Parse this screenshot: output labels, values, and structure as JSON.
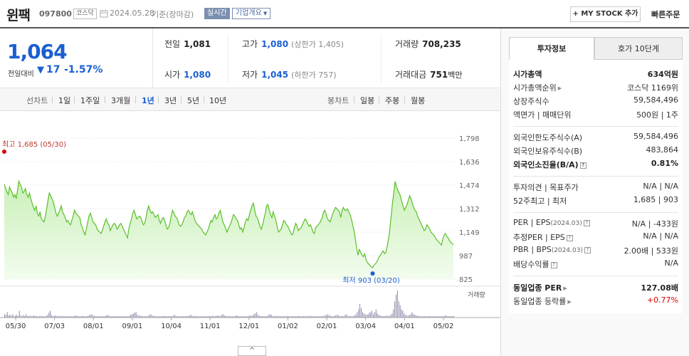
{
  "header": {
    "name": "윈팩",
    "code": "097800",
    "market": "코스닥",
    "date": "2024.05.28",
    "basis": "기준(장마감)",
    "realtime": "실시간",
    "overview": "기업개요",
    "mystock": "+ MY STOCK 추가",
    "quick_order": "빠른주문"
  },
  "price": {
    "current": "1,064",
    "change_label": "전일대비",
    "change_arrow": "▼",
    "change": "17",
    "change_pct": "-1.57%"
  },
  "quote": {
    "prev_label": "전일",
    "prev": "1,081",
    "high_label": "고가",
    "high": "1,080",
    "upper_limit": "(상한가 1,405)",
    "volume_label": "거래량",
    "volume": "708,235",
    "open_label": "시가",
    "open": "1,080",
    "low_label": "저가",
    "low": "1,045",
    "lower_limit": "(하한가 757)",
    "amount_label": "거래대금",
    "amount": "751",
    "amount_unit": "백만"
  },
  "period": {
    "line_label": "선차트",
    "line_tabs": [
      "1일",
      "1주일",
      "3개월",
      "1년",
      "3년",
      "5년",
      "10년"
    ],
    "active": "1년",
    "candle_label": "봉차트",
    "candle_tabs": [
      "일봉",
      "주봉",
      "월봉"
    ]
  },
  "chart_data": {
    "type": "area",
    "y_ticks": [
      "1,798",
      "1,636",
      "1,474",
      "1,312",
      "1,149",
      "987",
      "825"
    ],
    "ylim": [
      825,
      1798
    ],
    "x_ticks": [
      "05/30",
      "07/03",
      "08/01",
      "09/01",
      "10/04",
      "11/01",
      "12/01",
      "01/02",
      "02/01",
      "03/04",
      "04/01",
      "05/02"
    ],
    "high_annotation": "최고 1,685 (05/30)",
    "low_annotation": "최저 903 (03/20)",
    "volume_label": "거래량",
    "series": [
      {
        "values": [
          1480,
          1450,
          1430,
          1410,
          1460,
          1440,
          1420,
          1390,
          1410,
          1380,
          1440,
          1500,
          1480,
          1460,
          1420,
          1430,
          1450,
          1410,
          1390,
          1420,
          1380,
          1350,
          1320,
          1300,
          1330,
          1280,
          1260,
          1290,
          1240,
          1230,
          1220,
          1260,
          1310,
          1370,
          1420,
          1400,
          1380,
          1360,
          1320,
          1280,
          1260,
          1280,
          1300,
          1330,
          1290,
          1270,
          1250,
          1220,
          1230,
          1210,
          1200,
          1230,
          1260,
          1300,
          1280,
          1270,
          1260,
          1250,
          1200,
          1180,
          1150,
          1130,
          1170,
          1220,
          1260,
          1280,
          1250,
          1220,
          1210,
          1200,
          1170,
          1160,
          1150,
          1140,
          1160,
          1190,
          1220,
          1240,
          1210,
          1200,
          1160,
          1180,
          1200,
          1210,
          1200,
          1170,
          1180,
          1200,
          1210,
          1190,
          1170,
          1150,
          1130,
          1110,
          1170,
          1210,
          1240,
          1280,
          1300,
          1270,
          1240,
          1250,
          1260,
          1250,
          1220,
          1200,
          1210,
          1250,
          1300,
          1330,
          1300,
          1280,
          1290,
          1270,
          1250,
          1260,
          1270,
          1230,
          1210,
          1240,
          1250,
          1230,
          1200,
          1170,
          1180,
          1210,
          1260,
          1300,
          1280,
          1260,
          1250,
          1230,
          1200,
          1190,
          1200,
          1220,
          1250,
          1260,
          1290,
          1300,
          1280,
          1270,
          1290,
          1260,
          1230,
          1210,
          1200,
          1190,
          1180,
          1170,
          1150,
          1140,
          1130,
          1150,
          1170,
          1200,
          1230,
          1220,
          1250,
          1270,
          1240,
          1250,
          1280,
          1300,
          1260,
          1220,
          1200,
          1180,
          1150,
          1170,
          1190,
          1210,
          1240,
          1270,
          1260,
          1240,
          1230,
          1200,
          1170,
          1180,
          1150,
          1180,
          1220,
          1240,
          1230,
          1270,
          1300,
          1330,
          1350,
          1300,
          1260,
          1250,
          1220,
          1190,
          1170,
          1200,
          1240,
          1280,
          1330,
          1340,
          1300,
          1270,
          1250,
          1290,
          1260,
          1230,
          1190,
          1150,
          1160,
          1170,
          1200,
          1230,
          1220,
          1200,
          1190,
          1170,
          1150,
          1130,
          1140,
          1180,
          1210,
          1190,
          1160,
          1170,
          1180,
          1200,
          1220,
          1240,
          1230,
          1210,
          1190,
          1200,
          1180,
          1150,
          1140,
          1180,
          1190,
          1200,
          1210,
          1230,
          1250,
          1290,
          1300,
          1270,
          1240,
          1230,
          1220,
          1250,
          1280,
          1300,
          1320,
          1310,
          1300,
          1290,
          1250,
          1300,
          1320,
          1300,
          1300,
          1310,
          1290,
          1270,
          1240,
          1200,
          1160,
          1100,
          1040,
          990,
          1030,
          1010,
          990,
          980,
          1000,
          960,
          940,
          930,
          920,
          910,
          903,
          920,
          930,
          940,
          960,
          980,
          990,
          1010,
          1020,
          1000,
          1010,
          1050,
          1100,
          1170,
          1260,
          1350,
          1420,
          1500,
          1460,
          1440,
          1420,
          1400,
          1360,
          1330,
          1300,
          1320,
          1340,
          1370,
          1400,
          1380,
          1350,
          1320,
          1300,
          1290,
          1260,
          1240,
          1220,
          1200,
          1180,
          1160,
          1170,
          1200,
          1190,
          1170,
          1150,
          1140,
          1130,
          1120,
          1100,
          1090,
          1080,
          1070,
          1060,
          1100,
          1130,
          1140,
          1120,
          1110,
          1090,
          1080,
          1070,
          1064
        ]
      }
    ],
    "volume_values": [
      0.12,
      0.1,
      0.2,
      0.08,
      0.1,
      0.07,
      0.12,
      0.05,
      0.08,
      0.1,
      0.06,
      0.25,
      0.08,
      0.05,
      0.1,
      0.06,
      0.12,
      0.06,
      0.05,
      0.07,
      0.05,
      0.06,
      0.08,
      0.05,
      0.06,
      0.05,
      0.05,
      0.06,
      0.05,
      0.05,
      0.05,
      0.06,
      0.1,
      0.18,
      0.25,
      0.1,
      0.05,
      0.06,
      0.08,
      0.05,
      0.05,
      0.06,
      0.06,
      0.05,
      0.05,
      0.05,
      0.05,
      0.05,
      0.05,
      0.05,
      0.05,
      0.05,
      0.06,
      0.08,
      0.06,
      0.05,
      0.05,
      0.05,
      0.06,
      0.05,
      0.05,
      0.05,
      0.06,
      0.08,
      0.1,
      0.12,
      0.08,
      0.06,
      0.05,
      0.05,
      0.05,
      0.05,
      0.05,
      0.05,
      0.05,
      0.06,
      0.08,
      0.1,
      0.06,
      0.05,
      0.06,
      0.05,
      0.05,
      0.05,
      0.05,
      0.05,
      0.05,
      0.05,
      0.05,
      0.05,
      0.05,
      0.05,
      0.05,
      0.06,
      0.1,
      0.12,
      0.15,
      0.18,
      0.2,
      0.1,
      0.06,
      0.08,
      0.06,
      0.05,
      0.05,
      0.05,
      0.05,
      0.06,
      0.1,
      0.12,
      0.08,
      0.06,
      0.05,
      0.05,
      0.05,
      0.05,
      0.05,
      0.05,
      0.05,
      0.06,
      0.05,
      0.05,
      0.05,
      0.05,
      0.05,
      0.05,
      0.08,
      0.1,
      0.06,
      0.05,
      0.05,
      0.05,
      0.05,
      0.05,
      0.05,
      0.05,
      0.06,
      0.05,
      0.08,
      0.1,
      0.06,
      0.05,
      0.06,
      0.05,
      0.05,
      0.05,
      0.05,
      0.05,
      0.05,
      0.05,
      0.05,
      0.05,
      0.05,
      0.05,
      0.05,
      0.06,
      0.06,
      0.05,
      0.06,
      0.08,
      0.06,
      0.06,
      0.1,
      0.12,
      0.08,
      0.06,
      0.05,
      0.05,
      0.05,
      0.05,
      0.05,
      0.05,
      0.06,
      0.08,
      0.06,
      0.05,
      0.05,
      0.05,
      0.05,
      0.05,
      0.05,
      0.05,
      0.06,
      0.08,
      0.06,
      0.08,
      0.12,
      0.15,
      0.2,
      0.1,
      0.06,
      0.06,
      0.05,
      0.05,
      0.05,
      0.05,
      0.06,
      0.1,
      0.12,
      0.1,
      0.06,
      0.05,
      0.06,
      0.06,
      0.05,
      0.05,
      0.05,
      0.05,
      0.05,
      0.05,
      0.05,
      0.06,
      0.05,
      0.05,
      0.05,
      0.05,
      0.05,
      0.05,
      0.05,
      0.06,
      0.05,
      0.05,
      0.05,
      0.05,
      0.05,
      0.05,
      0.05,
      0.06,
      0.06,
      0.05,
      0.05,
      0.05,
      0.05,
      0.05,
      0.05,
      0.05,
      0.05,
      0.06,
      0.06,
      0.08,
      0.1,
      0.12,
      0.08,
      0.06,
      0.05,
      0.05,
      0.06,
      0.08,
      0.1,
      0.08,
      0.06,
      0.05,
      0.06,
      0.05,
      0.1,
      0.12,
      0.06,
      0.05,
      0.06,
      0.05,
      0.06,
      0.08,
      0.12,
      0.2,
      0.3,
      0.5,
      0.35,
      0.2,
      0.15,
      0.12,
      0.1,
      0.12,
      0.18,
      0.2,
      0.25,
      0.12,
      0.2,
      0.3,
      0.15,
      0.1,
      0.08,
      0.06,
      0.06,
      0.05,
      0.06,
      0.08,
      0.06,
      0.06,
      0.1,
      0.15,
      0.3,
      0.6,
      0.85,
      1.0,
      0.6,
      0.45,
      0.3,
      0.25,
      0.15,
      0.1,
      0.08,
      0.06,
      0.1,
      0.12,
      0.2,
      0.12,
      0.1,
      0.08,
      0.06,
      0.06,
      0.05,
      0.05,
      0.05,
      0.05,
      0.05,
      0.05,
      0.05,
      0.06,
      0.05,
      0.05,
      0.05,
      0.05,
      0.05,
      0.05,
      0.05,
      0.05,
      0.05,
      0.05,
      0.06,
      0.08,
      0.06,
      0.05,
      0.05,
      0.05,
      0.05,
      0.06
    ]
  },
  "collapse_button": "^",
  "right_panel": {
    "tab_invest": "투자정보",
    "tab_orderbook": "호가 10단계",
    "market_cap_label": "시가총액",
    "market_cap": "634억원",
    "market_cap_rank_label": "시가총액순위",
    "market_cap_rank": "코스닥 1169위",
    "shares_label": "상장주식수",
    "shares": "59,584,496",
    "par_label": "액면가 | 매매단위",
    "par": "500원 | 1주",
    "foreign_limit_label": "외국인한도주식수(A)",
    "foreign_limit": "59,584,496",
    "foreign_hold_label": "외국인보유주식수(B)",
    "foreign_hold": "483,864",
    "foreign_ratio_label": "외국인소진율(B/A)",
    "foreign_ratio": "0.81%",
    "opinion_label": "투자의견 | 목표주가",
    "opinion": "N/A | N/A",
    "week52_label": "52주최고 | 최저",
    "week52": "1,685 | 903",
    "per_label": "PER | EPS",
    "per_date": "(2024.03)",
    "per": "N/A | -433원",
    "est_per_label": "추정PER | EPS",
    "est_per": "N/A | N/A",
    "pbr_label": "PBR | BPS",
    "pbr_date": "(2024.03)",
    "pbr": "2.00배 | 533원",
    "dividend_label": "배당수익률",
    "dividend": "N/A",
    "industry_per_label": "동일업종 PER",
    "industry_per": "127.08배",
    "industry_rate_label": "동일업종 등락률",
    "industry_rate": "+0.77%"
  }
}
